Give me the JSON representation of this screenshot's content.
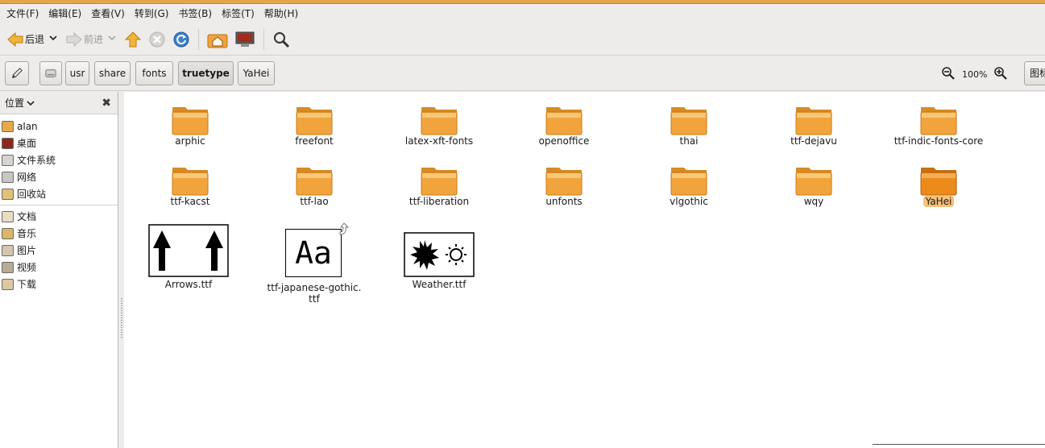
{
  "menu": [
    "文件(F)",
    "编辑(E)",
    "查看(V)",
    "转到(G)",
    "书签(B)",
    "标签(T)",
    "帮助(H)"
  ],
  "toolbar": {
    "back_label": "后退",
    "forward_label": "前进"
  },
  "breadcrumbs": [
    "usr",
    "share",
    "fonts",
    "truetype",
    "YaHei"
  ],
  "zoom": {
    "value": "100%"
  },
  "view_select": "图标",
  "sidebar": {
    "header": "位置",
    "places": [
      {
        "label": "alan",
        "icon": "home-icon"
      },
      {
        "label": "桌面",
        "icon": "desktop-icon"
      },
      {
        "label": "文件系统",
        "icon": "filesystem-icon"
      },
      {
        "label": "网络",
        "icon": "network-icon"
      },
      {
        "label": "回收站",
        "icon": "trash-icon"
      }
    ],
    "bookmarks": [
      {
        "label": "文档",
        "icon": "documents-icon"
      },
      {
        "label": "音乐",
        "icon": "music-icon"
      },
      {
        "label": "图片",
        "icon": "pictures-icon"
      },
      {
        "label": "视频",
        "icon": "videos-icon"
      },
      {
        "label": "下载",
        "icon": "downloads-icon"
      }
    ]
  },
  "files": {
    "folders": [
      {
        "name": "arphic"
      },
      {
        "name": "freefont"
      },
      {
        "name": "latex-xft-fonts"
      },
      {
        "name": "openoffice"
      },
      {
        "name": "thai"
      },
      {
        "name": "ttf-dejavu"
      },
      {
        "name": "ttf-indic-fonts-core"
      },
      {
        "name": "ttf-kacst"
      },
      {
        "name": "ttf-lao"
      },
      {
        "name": "ttf-liberation"
      },
      {
        "name": "unfonts"
      },
      {
        "name": "vlgothic"
      },
      {
        "name": "wqy"
      },
      {
        "name": "YaHei",
        "selected": true
      }
    ],
    "font_files": [
      {
        "name": "Arrows.ttf"
      },
      {
        "name": "ttf-japanese-gothic.ttf",
        "name_line1": "ttf-japanese-gothic.",
        "name_line2": "ttf",
        "preview": "Aa",
        "link_emblem": true
      },
      {
        "name": "Weather.ttf"
      }
    ]
  }
}
